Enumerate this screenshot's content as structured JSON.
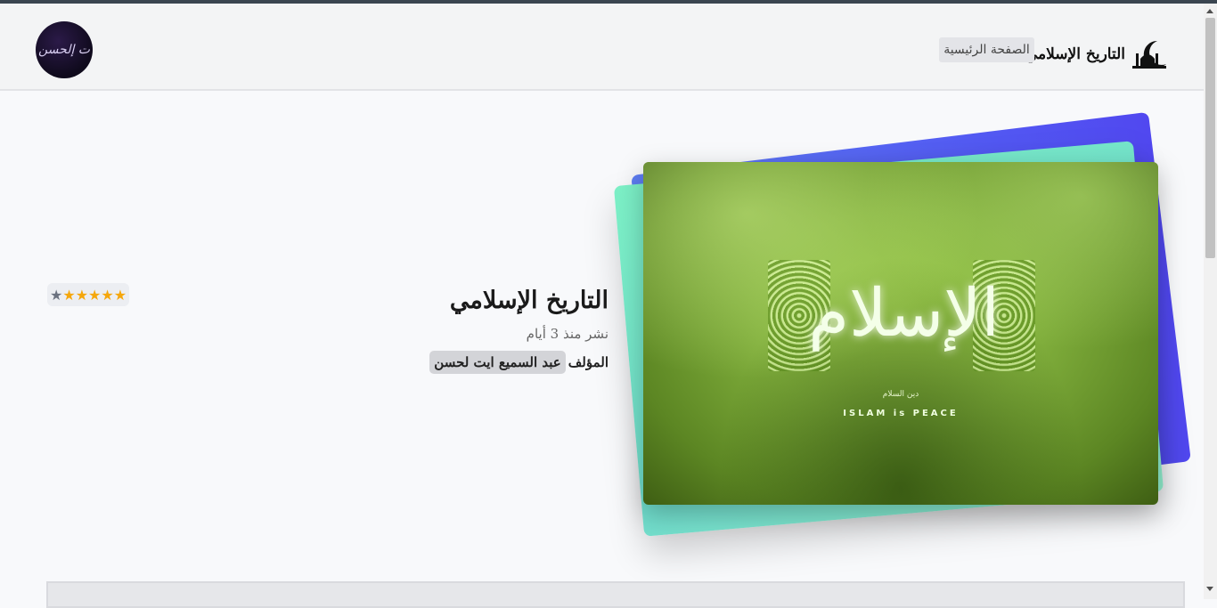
{
  "header": {
    "brand_name": "التاريخ الإسلامي",
    "brand_icon": "mosque-crescent-icon",
    "nav_home": "الصفحة الرئيسية",
    "avatar_text": "ت إلحسن"
  },
  "post": {
    "title": "التاريخ الإسلامي",
    "date": "نشر منذ 3 أيام",
    "author_label": "المؤلف",
    "author_name": "عبد السميع ايت لحسن",
    "rating": {
      "value": 5,
      "max": 5,
      "stars": [
        "★",
        "★",
        "★",
        "★",
        "★"
      ],
      "extra_star": "★"
    },
    "image": {
      "calligraphy": "الإسلام",
      "subtitle_ar": "دين السلام",
      "subtitle_en": "ISLAM is PEACE"
    }
  },
  "colors": {
    "accent_blue": "#5148f0",
    "accent_green": "#7cf0c6",
    "star": "#f5a70c"
  }
}
